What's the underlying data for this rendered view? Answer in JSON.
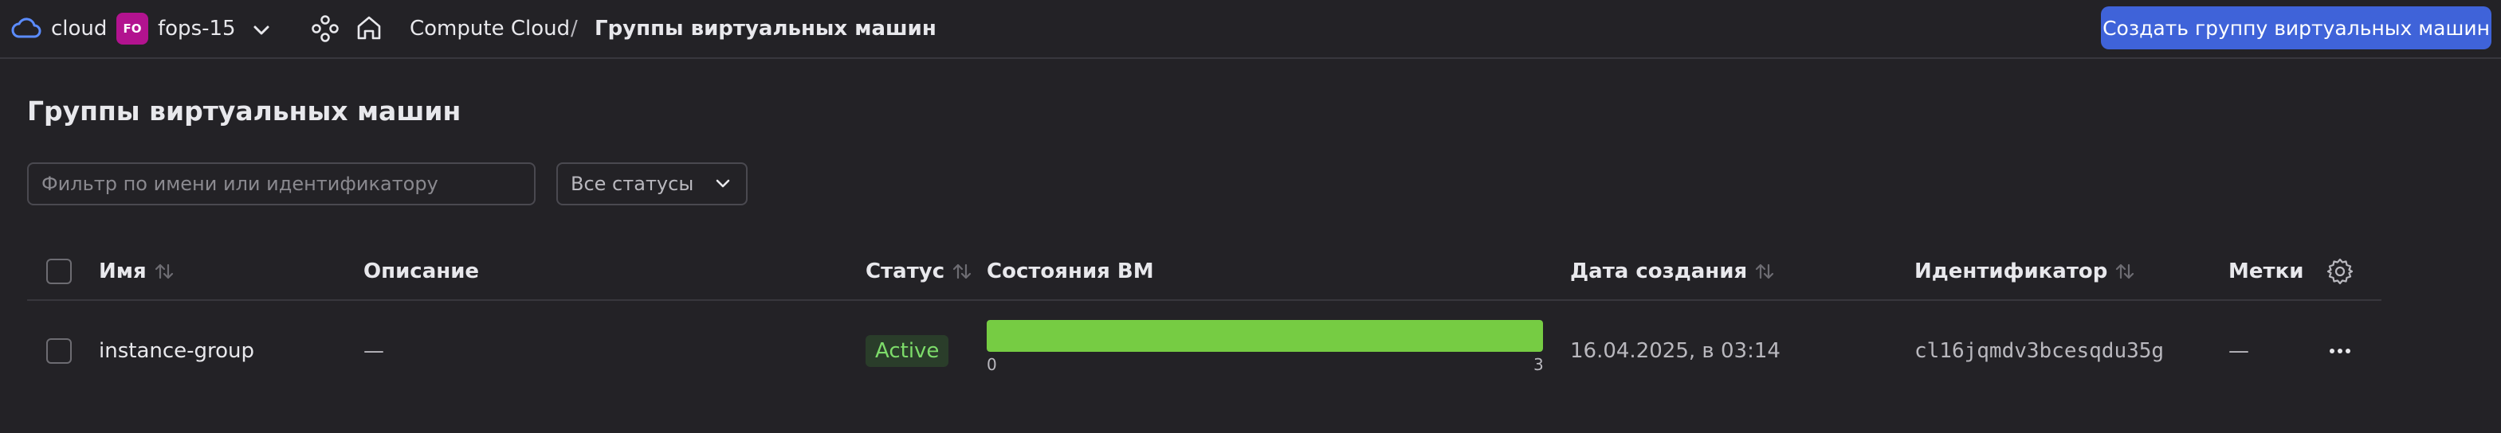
{
  "topbar": {
    "cloud_label": "cloud",
    "folder_avatar": "FO",
    "folder_name": "fops-15",
    "breadcrumb": {
      "service": "Compute Cloud",
      "separator": "/",
      "current": "Группы виртуальных машин"
    },
    "create_button": "Создать группу виртуальных машин"
  },
  "page": {
    "title": "Группы виртуальных машин"
  },
  "filters": {
    "search_placeholder": "Фильтр по имени или идентификатору",
    "status_value": "Все статусы"
  },
  "table": {
    "columns": {
      "name": "Имя",
      "description": "Описание",
      "status": "Статус",
      "vm_states": "Состояния ВМ",
      "created": "Дата создания",
      "id": "Идентификатор",
      "labels": "Метки"
    },
    "rows": [
      {
        "name": "instance-group",
        "description": "—",
        "status": "Active",
        "vm_states": {
          "min": "0",
          "max": "3",
          "fill_fraction": 1.0
        },
        "created": "16.04.2025, в 03:14",
        "id": "cl16jqmdv3bcesqdu35g",
        "labels": "—"
      }
    ]
  },
  "colors": {
    "background": "#232226",
    "accent_button": "#3f63d9",
    "folder_avatar": "#b2138f",
    "status_active_text": "#7ddc6a",
    "vm_bar": "#76cc43"
  },
  "icons": {
    "cloud": "cloud-icon",
    "folder_chevron": "chevron-down-icon",
    "services": "services-icon",
    "home": "home-icon",
    "sort": "sort-icon",
    "settings": "gear-icon",
    "more": "more-icon"
  }
}
